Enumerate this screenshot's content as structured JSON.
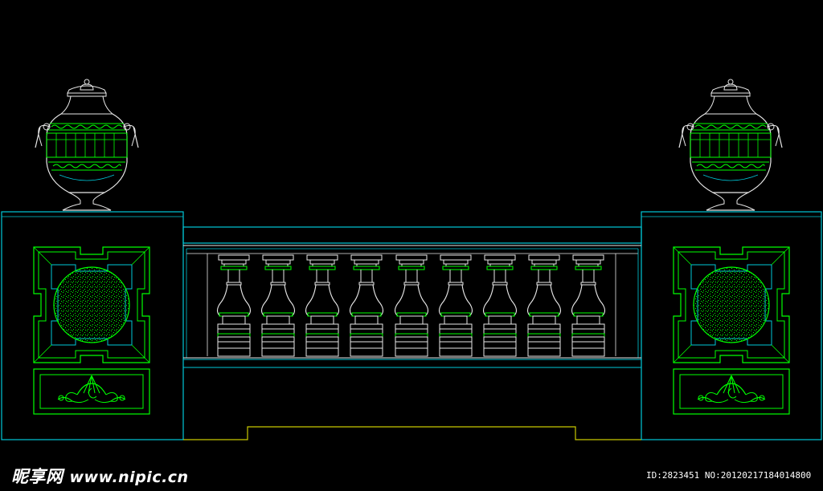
{
  "watermark": {
    "brand": "昵享网",
    "url": "www.nipic.cn",
    "id_line": "ID:2823451 NO:20120217184014800"
  },
  "colors": {
    "cyan": "#00c8d8",
    "green": "#00ff00",
    "white": "#e8e8e8",
    "yellow": "#c8c800",
    "background": "#000000"
  },
  "drawing": {
    "baluster_count": 9,
    "urn_count": 2,
    "pedestal_count": 2
  }
}
